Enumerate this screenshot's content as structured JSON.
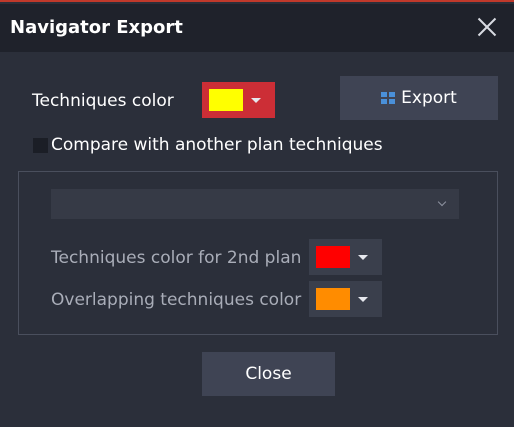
{
  "window": {
    "title": "Navigator Export",
    "accent_color": "#cc2e36"
  },
  "primary": {
    "label": "Techniques color",
    "color": "#ffff00"
  },
  "export_button": {
    "label": "Export",
    "icon": "windows-grid-icon"
  },
  "compare": {
    "label": "Compare with another plan techniques",
    "checked": false
  },
  "plan_select": {
    "value": ""
  },
  "second_plan": {
    "label": "Techniques color for 2nd plan",
    "color": "#ff0000"
  },
  "overlap": {
    "label": "Overlapping techniques color",
    "color": "#ff8c00"
  },
  "close_button": {
    "label": "Close"
  }
}
